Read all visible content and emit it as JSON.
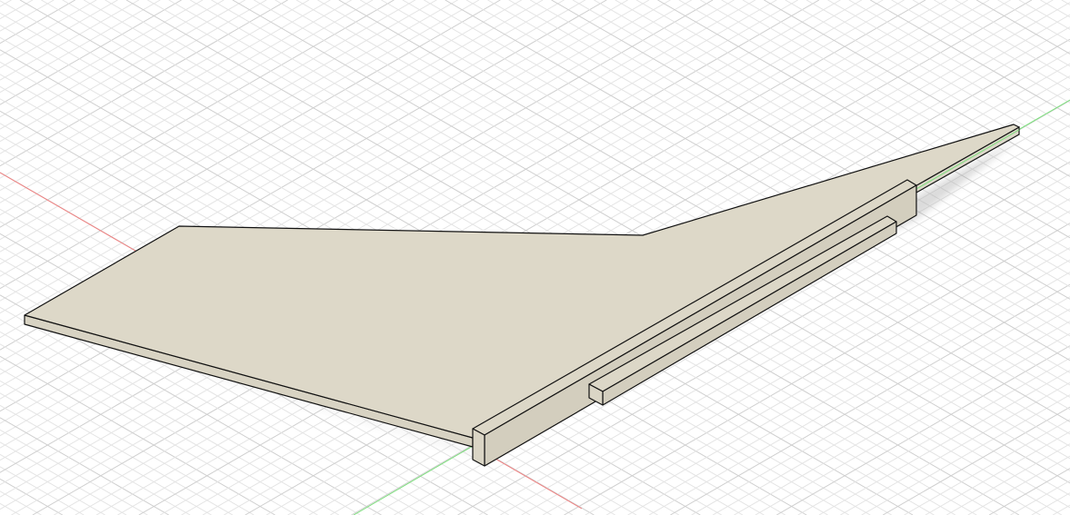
{
  "viewport": {
    "background": "#ffffff",
    "grid_minor_color": "#e4e4e4",
    "grid_major_color": "#cfcfcf",
    "x_axis_color": "#f08080",
    "y_axis_color": "#7ee07e",
    "body_top_color": "#ddd8c8",
    "body_side_color": "#d2cdbd",
    "edge_color": "#111111"
  }
}
